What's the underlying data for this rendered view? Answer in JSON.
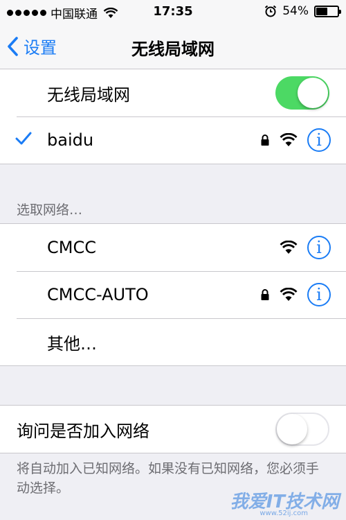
{
  "status_bar": {
    "carrier": "中国联通",
    "time": "17:35",
    "battery_percent_label": "54%",
    "battery_level": 0.54
  },
  "nav": {
    "back_label": "设置",
    "title": "无线局域网"
  },
  "wifi_toggle": {
    "label": "无线局域网",
    "state": "on"
  },
  "connected_network": {
    "name": "baidu",
    "locked": true,
    "info_icon_glyph": "i"
  },
  "choose_network": {
    "header": "选取网络…",
    "networks": [
      {
        "name": "CMCC",
        "locked": false
      },
      {
        "name": "CMCC-AUTO",
        "locked": true
      }
    ],
    "other_label": "其他…"
  },
  "ask_to_join": {
    "label": "询问是否加入网络",
    "state": "off",
    "footer": "将自动加入已知网络。如果没有已知网络，您必须手动选择。"
  },
  "watermark": {
    "text": "我爱IT技术网",
    "url": "www.52ij.com"
  },
  "colors": {
    "accent": "#1a7cf5",
    "toggle_on": "#4cd964",
    "background": "#efeff4"
  }
}
